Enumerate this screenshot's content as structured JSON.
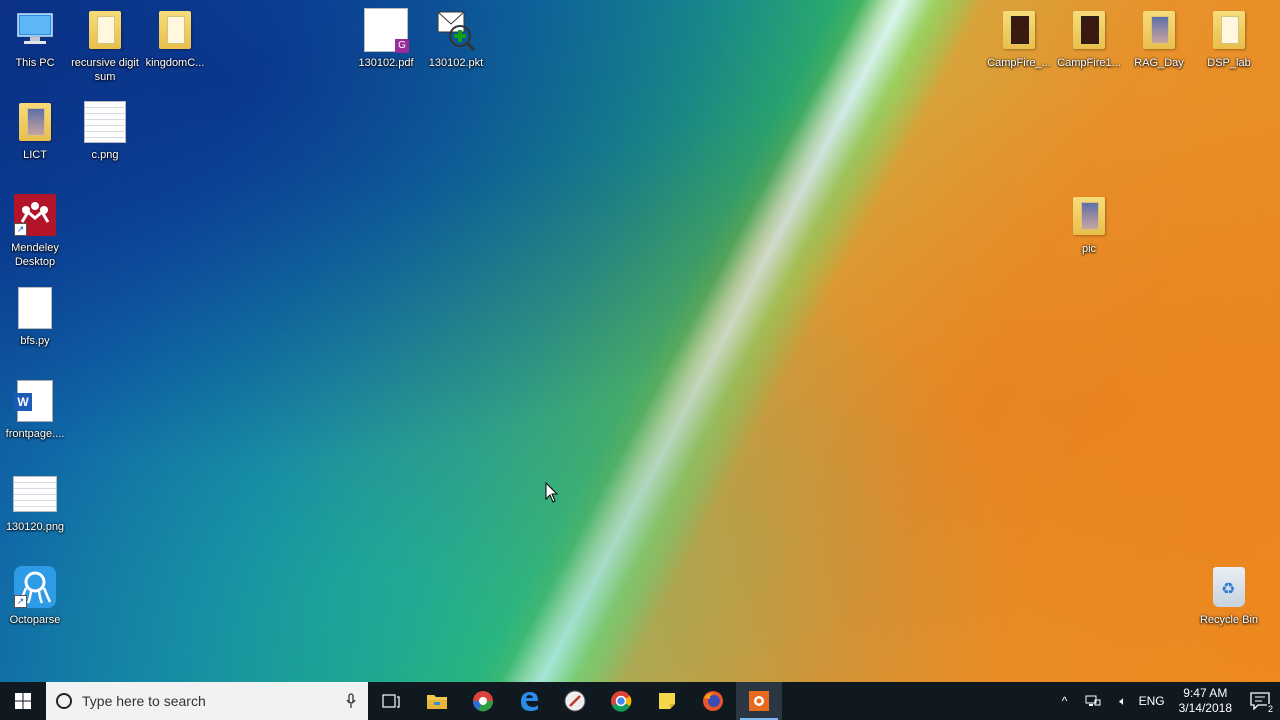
{
  "desktop": {
    "icons": [
      {
        "label": "This PC"
      },
      {
        "label": "recursive digit sum"
      },
      {
        "label": "kingdomC..."
      },
      {
        "label": "130102.pdf"
      },
      {
        "label": "130102.pkt"
      },
      {
        "label": "CampFire_..."
      },
      {
        "label": "CampFire1..."
      },
      {
        "label": "RAG_Day"
      },
      {
        "label": "DSP_lab"
      },
      {
        "label": "LICT"
      },
      {
        "label": "c.png"
      },
      {
        "label": "Mendeley Desktop"
      },
      {
        "label": "bfs.py"
      },
      {
        "label": "frontpage...."
      },
      {
        "label": "130120.png"
      },
      {
        "label": "Octoparse"
      },
      {
        "label": "pic"
      },
      {
        "label": "Recycle Bin"
      }
    ]
  },
  "taskbar": {
    "search_placeholder": "Type here to search",
    "apps": [
      "task-view",
      "file-explorer",
      "chrome-remote",
      "edge",
      "clock-app",
      "chrome",
      "sticky-notes",
      "firefox",
      "active-app"
    ],
    "tray": {
      "language": "ENG",
      "time": "9:47 AM",
      "date": "3/14/2018",
      "notification_count": "2"
    }
  },
  "colors": {
    "taskbar_bg": "#101820",
    "search_bg": "#f2f2f2",
    "active_accent": "#7fb8f0"
  }
}
